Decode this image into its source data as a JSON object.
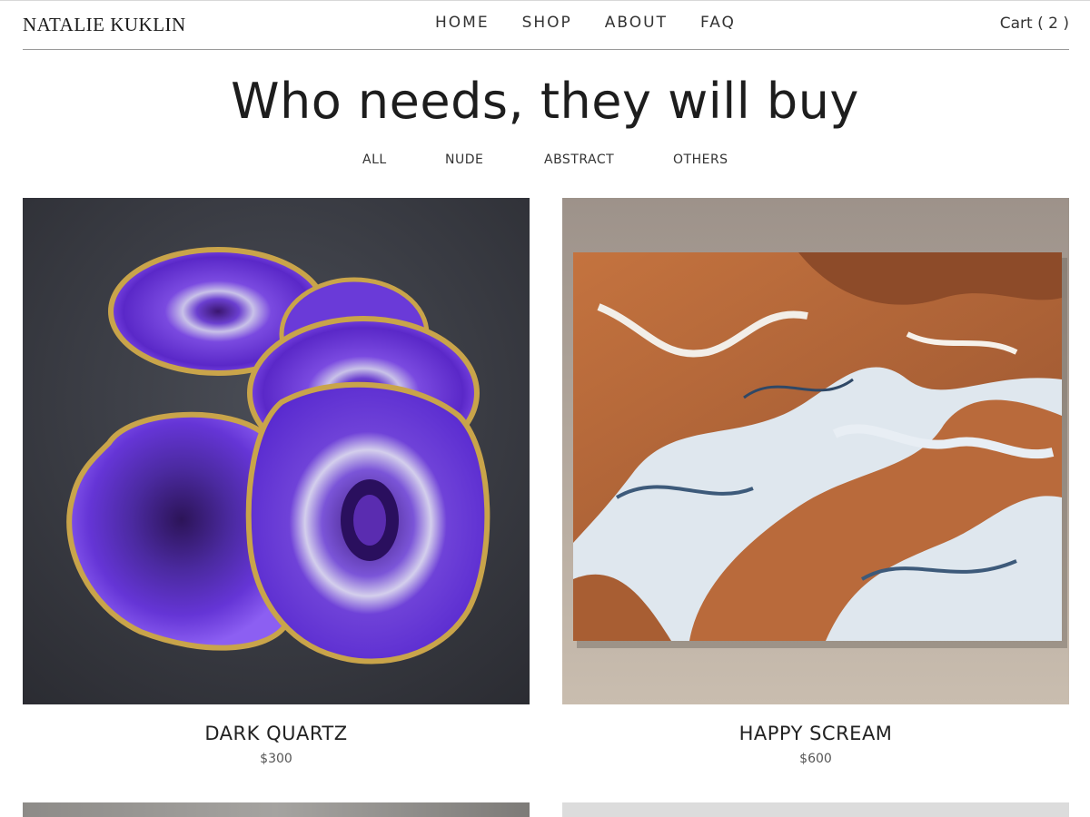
{
  "site": {
    "brand": "NATALIE KUKLIN",
    "nav": [
      "HOME",
      "SHOP",
      "ABOUT",
      "FAQ"
    ],
    "cart_label": "Cart ( 2 )"
  },
  "page": {
    "headline": "Who needs, they will buy",
    "filters": [
      "ALL",
      "NUDE",
      "ABSTRACT",
      "OTHERS"
    ]
  },
  "products": [
    {
      "title": "DARK QUARTZ",
      "price": "$300",
      "image": "purple-agate-coasters-photo"
    },
    {
      "title": "HAPPY SCREAM",
      "price": "$600",
      "image": "copper-white-fluid-art-canvas-photo"
    }
  ],
  "colors": {
    "text": "#222222",
    "divider": "#9a9a9a",
    "agate_purple": "#6a2fd8",
    "canvas_copper": "#b8673b"
  }
}
